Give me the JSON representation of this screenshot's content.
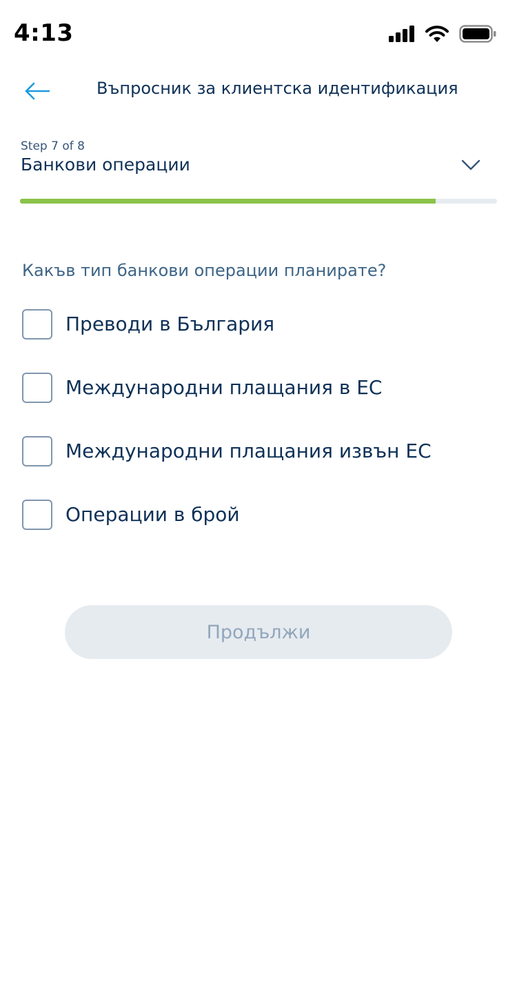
{
  "status_bar": {
    "time": "4:13"
  },
  "header": {
    "title": "Въпросник за клиентска идентификация"
  },
  "step": {
    "label": "Step 7 of 8",
    "title": "Банкови операции",
    "progress": 0.872
  },
  "question": "Какъв тип банкови операции планирате?",
  "options": [
    {
      "label": "Преводи в България",
      "checked": false
    },
    {
      "label": "Международни плащания в ЕС",
      "checked": false
    },
    {
      "label": "Международни плащания извън ЕС",
      "checked": false
    },
    {
      "label": "Операции в брой",
      "checked": false
    }
  ],
  "continue_button": {
    "label": "Продължи",
    "enabled": false
  },
  "colors": {
    "primary_text": "#0f3157",
    "accent_blue": "#1e9be0",
    "progress_green": "#8bc34a",
    "disabled_button_bg": "#e6ebf0",
    "disabled_button_text": "#91a6bb"
  }
}
